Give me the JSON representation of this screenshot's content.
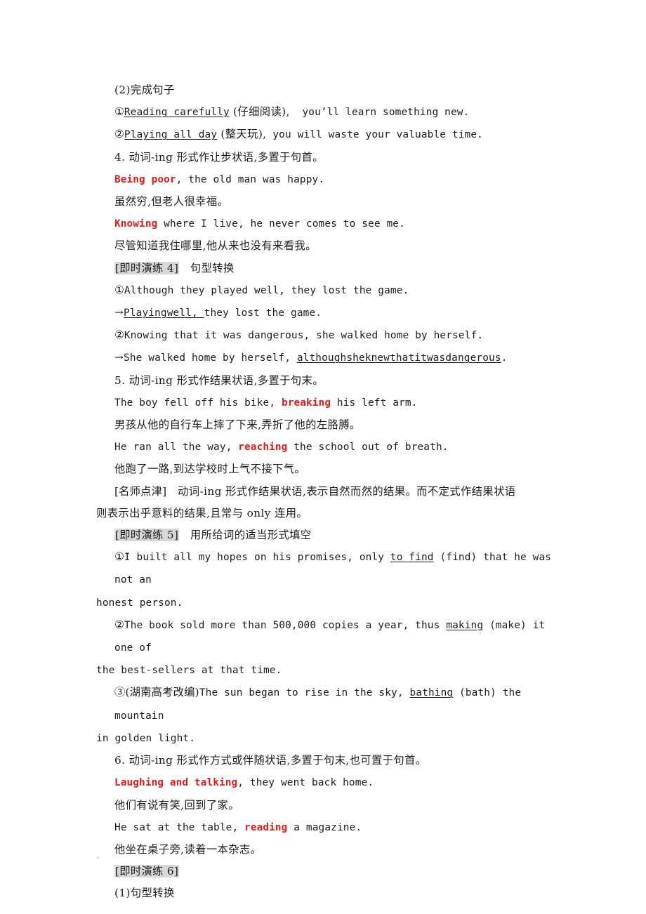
{
  "document": {
    "language": "zh-CN + en",
    "page_background": "#ffffff",
    "text_color": "#1c1c1c",
    "accent_color": "#e8191b",
    "tag_background": "#d8d8d8"
  },
  "lines": [
    {
      "id": "l01",
      "indent": true,
      "runs": [
        {
          "text": "(2)完成句子",
          "style": "cn"
        }
      ]
    },
    {
      "id": "l02",
      "indent": true,
      "runs": [
        {
          "text": "①",
          "style": "cn-tight"
        },
        {
          "text": "Reading carefully",
          "style": "en-ul"
        },
        {
          "text": " (仔细阅读),",
          "style": "cn"
        },
        {
          "text": "  you’ll learn something new.",
          "style": "en"
        }
      ]
    },
    {
      "id": "l03",
      "indent": true,
      "runs": [
        {
          "text": "②",
          "style": "cn-tight"
        },
        {
          "text": "Playing all day",
          "style": "en-ul"
        },
        {
          "text": " (整天玩),",
          "style": "cn"
        },
        {
          "text": " you will waste your valuable time.",
          "style": "en"
        }
      ]
    },
    {
      "id": "l04",
      "indent": true,
      "runs": [
        {
          "text": "4. 动词-ing 形式作让步状语,多置于句首。",
          "style": "cn"
        }
      ]
    },
    {
      "id": "l05",
      "indent": true,
      "runs": [
        {
          "text": "Being poor",
          "style": "red"
        },
        {
          "text": ", the old man was happy.",
          "style": "en"
        }
      ]
    },
    {
      "id": "l06",
      "indent": true,
      "runs": [
        {
          "text": "虽然穷,但老人很幸福。",
          "style": "cn"
        }
      ]
    },
    {
      "id": "l07",
      "indent": true,
      "runs": [
        {
          "text": "Knowing",
          "style": "red"
        },
        {
          "text": " where I live, he never comes to see me.",
          "style": "en"
        }
      ]
    },
    {
      "id": "l08",
      "indent": true,
      "runs": [
        {
          "text": "尽管知道我住哪里,他从来也没有来看我。",
          "style": "cn"
        }
      ]
    },
    {
      "id": "l09",
      "indent": true,
      "runs": [
        {
          "text": "[即时演练 4]",
          "style": "tag"
        },
        {
          "text": "   句型转换",
          "style": "cn"
        }
      ]
    },
    {
      "id": "l10",
      "indent": true,
      "runs": [
        {
          "text": "①",
          "style": "cn-tight"
        },
        {
          "text": "Although they played well, they lost the game.",
          "style": "en"
        }
      ]
    },
    {
      "id": "l11",
      "indent": true,
      "runs": [
        {
          "text": "→",
          "style": "cn-tight"
        },
        {
          "text": "Playingwell, ",
          "style": "en-ul"
        },
        {
          "text": "they lost the game.",
          "style": "en"
        }
      ]
    },
    {
      "id": "l12",
      "indent": true,
      "runs": [
        {
          "text": "②",
          "style": "cn-tight"
        },
        {
          "text": "Knowing that it was dangerous, she walked home by herself.",
          "style": "en"
        }
      ]
    },
    {
      "id": "l13",
      "indent": true,
      "runs": [
        {
          "text": "→",
          "style": "cn-tight"
        },
        {
          "text": "She walked home by herself, ",
          "style": "en"
        },
        {
          "text": "althoughsheknewthatitwasdangerous",
          "style": "en-ul"
        },
        {
          "text": ".",
          "style": "en"
        }
      ]
    },
    {
      "id": "l14",
      "indent": true,
      "runs": [
        {
          "text": "5. 动词-ing 形式作结果状语,多置于句末。",
          "style": "cn"
        }
      ]
    },
    {
      "id": "l15",
      "indent": true,
      "runs": [
        {
          "text": "The boy fell off his bike, ",
          "style": "en"
        },
        {
          "text": "breaking",
          "style": "red"
        },
        {
          "text": " his left arm.",
          "style": "en"
        }
      ]
    },
    {
      "id": "l16",
      "indent": true,
      "runs": [
        {
          "text": "男孩从他的自行车上摔了下来,弄折了他的左胳膊。",
          "style": "cn"
        }
      ]
    },
    {
      "id": "l17",
      "indent": true,
      "runs": [
        {
          "text": "He ran all the way, ",
          "style": "en"
        },
        {
          "text": "reaching",
          "style": "red"
        },
        {
          "text": " the school out of breath.",
          "style": "en"
        }
      ]
    },
    {
      "id": "l18",
      "indent": true,
      "runs": [
        {
          "text": "他跑了一路,到达学校时上气不接下气。",
          "style": "cn"
        }
      ]
    },
    {
      "id": "l19",
      "indent": true,
      "runs": [
        {
          "text": "[名师点津]",
          "style": "cn-tight"
        },
        {
          "text": "   动词-ing 形式作结果状语,表示自然而然的结果。而不定式作结果状语",
          "style": "cn"
        }
      ]
    },
    {
      "id": "l20",
      "indent": false,
      "runs": [
        {
          "text": "则表示出乎意料的结果,且常与 only 连用。",
          "style": "cn"
        }
      ]
    },
    {
      "id": "l21",
      "indent": true,
      "runs": [
        {
          "text": "[即时演练 5]",
          "style": "tag"
        },
        {
          "text": "   用所给词的适当形式填空",
          "style": "cn"
        }
      ]
    },
    {
      "id": "l22",
      "indent": true,
      "runs": [
        {
          "text": "①",
          "style": "cn-tight"
        },
        {
          "text": "I built all my hopes on his promises, only ",
          "style": "en"
        },
        {
          "text": "to find",
          "style": "en-ul"
        },
        {
          "text": " (find) that he was not an",
          "style": "en"
        }
      ]
    },
    {
      "id": "l23",
      "indent": false,
      "runs": [
        {
          "text": "honest person.",
          "style": "en"
        }
      ]
    },
    {
      "id": "l24",
      "indent": true,
      "runs": [
        {
          "text": "②",
          "style": "cn-tight"
        },
        {
          "text": "The book sold more than 500,000 copies a year, thus ",
          "style": "en"
        },
        {
          "text": "making",
          "style": "en-ul"
        },
        {
          "text": " (make) it one of",
          "style": "en"
        }
      ]
    },
    {
      "id": "l25",
      "indent": false,
      "runs": [
        {
          "text": "the best-sellers at that time.",
          "style": "en"
        }
      ]
    },
    {
      "id": "l26",
      "indent": true,
      "runs": [
        {
          "text": "③",
          "style": "cn-tight"
        },
        {
          "text": "(湖南高考改编)",
          "style": "cn-tight"
        },
        {
          "text": "The sun began to rise in the sky, ",
          "style": "en"
        },
        {
          "text": "bathing",
          "style": "en-ul"
        },
        {
          "text": " (bath) the mountain",
          "style": "en"
        }
      ]
    },
    {
      "id": "l27",
      "indent": false,
      "runs": [
        {
          "text": "in golden light.",
          "style": "en"
        }
      ]
    },
    {
      "id": "l28",
      "indent": true,
      "runs": [
        {
          "text": "6. 动词-ing 形式作方式或伴随状语,多置于句末,也可置于句首。",
          "style": "cn"
        }
      ]
    },
    {
      "id": "l29",
      "indent": true,
      "runs": [
        {
          "text": "Laughing and talking",
          "style": "red"
        },
        {
          "text": ", they went back home.",
          "style": "en"
        }
      ]
    },
    {
      "id": "l30",
      "indent": true,
      "runs": [
        {
          "text": "他们有说有笑,回到了家。",
          "style": "cn"
        }
      ]
    },
    {
      "id": "l31",
      "indent": true,
      "runs": [
        {
          "text": "He sat at the table, ",
          "style": "en"
        },
        {
          "text": "reading",
          "style": "red"
        },
        {
          "text": " a magazine.",
          "style": "en"
        }
      ]
    },
    {
      "id": "l32",
      "indent": true,
      "runs": [
        {
          "text": "他坐在桌子旁,读着一本杂志。",
          "style": "cn"
        }
      ]
    },
    {
      "id": "l33",
      "indent": true,
      "runs": [
        {
          "text": "[即时演练 6]",
          "style": "tag"
        }
      ]
    },
    {
      "id": "l34",
      "indent": true,
      "runs": [
        {
          "text": "(1)句型转换",
          "style": "cn"
        }
      ]
    }
  ]
}
